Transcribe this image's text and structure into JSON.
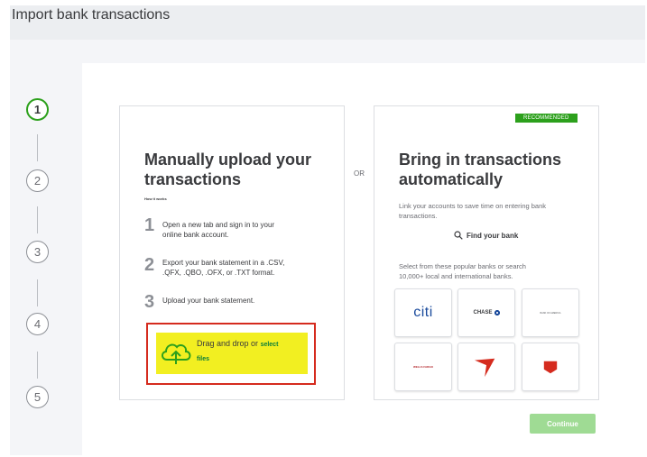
{
  "header": {
    "title": "Import bank transactions"
  },
  "steps": [
    "1",
    "2",
    "3",
    "4",
    "5"
  ],
  "manual": {
    "title_line1": "Manually upload your",
    "title_line2": "transactions",
    "how_it_works": "How it works",
    "step1_num": "1",
    "step1_line1": "Open a new tab and sign in to your",
    "step1_line2": "online bank account.",
    "step2_num": "2",
    "step2_line1": "Export your bank statement in a .CSV,",
    "step2_line2": ".QFX, .QBO, .OFX, or .TXT format.",
    "step3_num": "3",
    "step3_line1": "Upload your bank statement.",
    "drag_text": "Drag and drop or",
    "select_text": "select",
    "files_text": "files"
  },
  "or_label": "OR",
  "auto": {
    "badge": "RECOMMENDED",
    "title_line1": "Bring in transactions",
    "title_line2": "automatically",
    "link_desc_line1": "Link your accounts to save time on entering bank",
    "link_desc_line2": "transactions.",
    "find_bank": "Find your bank",
    "select_desc_line1": "Select from these popular banks or search",
    "select_desc_line2": "10,000+ local and international banks."
  },
  "banks": {
    "citi": "citi",
    "chase": "CHASE",
    "boa": "BANK OF AMERICA",
    "wells": "WELLS FARGO"
  },
  "continue_label": "Continue",
  "colors": {
    "brand_green": "#2ca01c",
    "highlight_yellow": "#f2ef21",
    "annotation_red": "#d52b1e",
    "continue_disabled": "#9fdb94"
  }
}
